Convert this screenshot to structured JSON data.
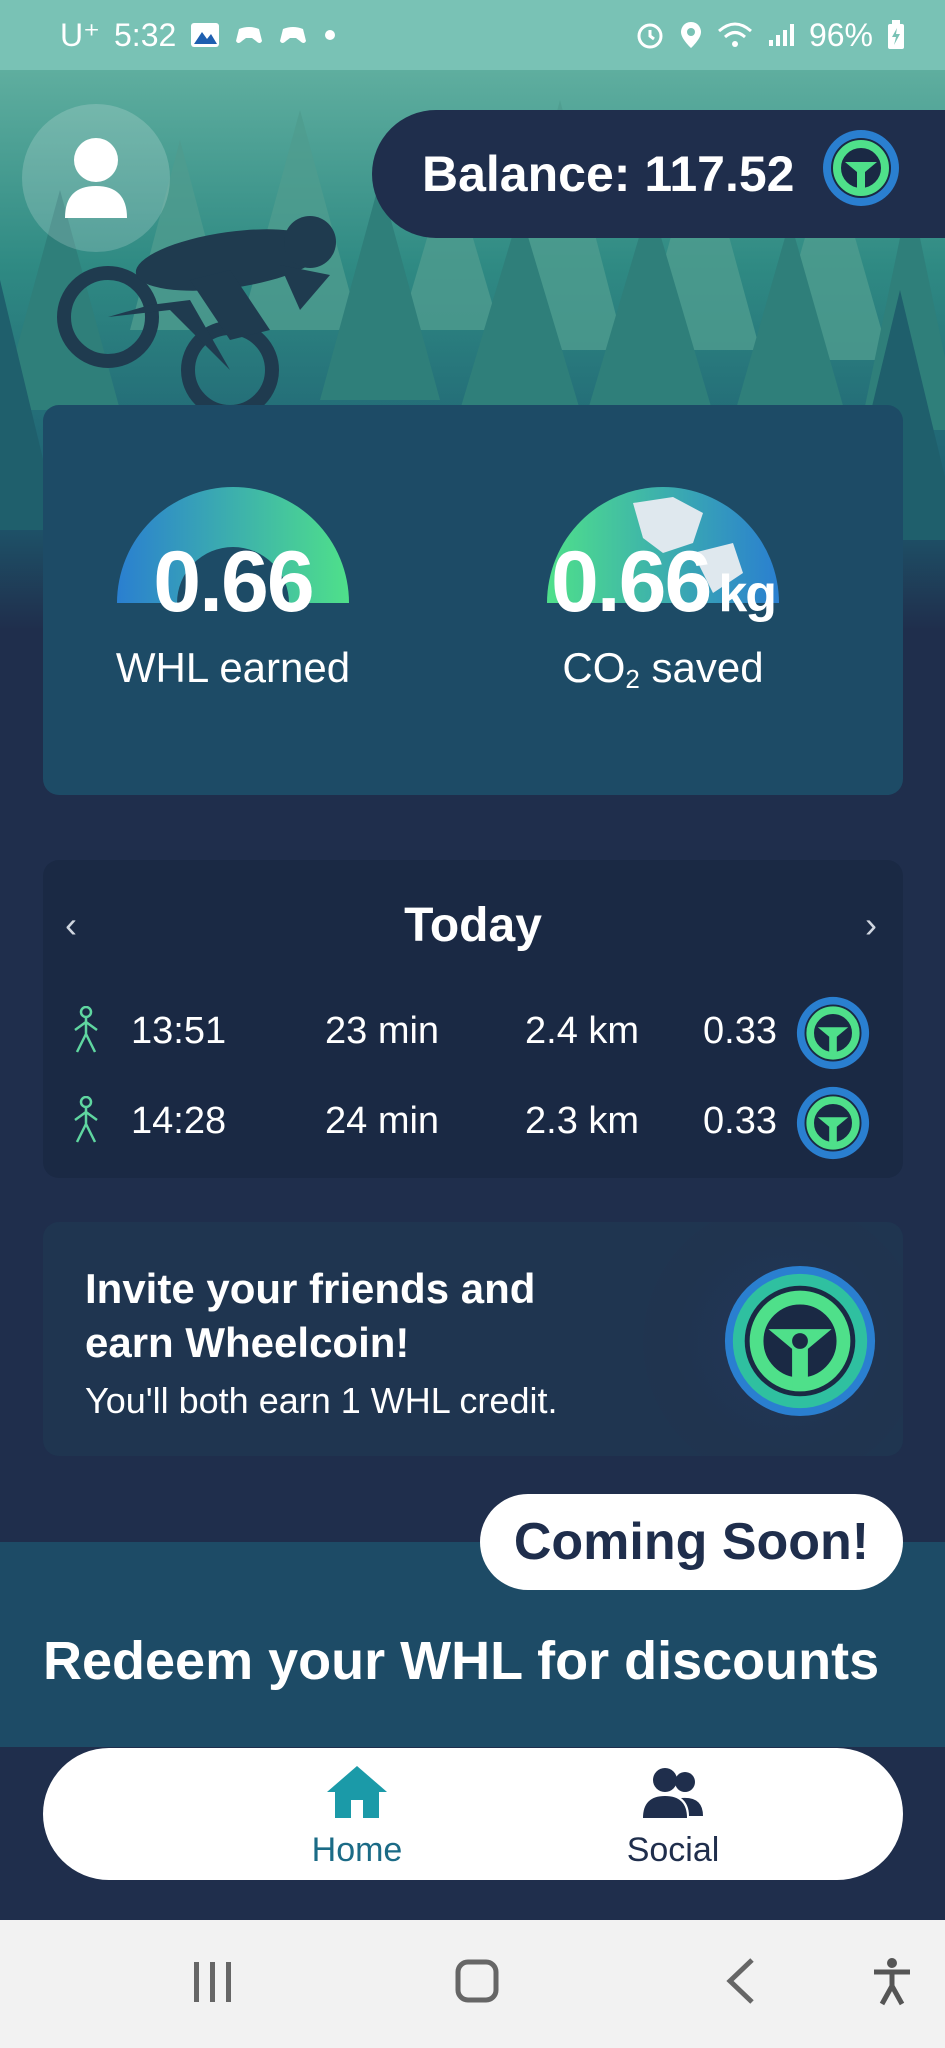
{
  "status_bar": {
    "carrier": "U⁺",
    "time": "5:32",
    "battery": "96%"
  },
  "header": {
    "balance_label": "Balance: 117.52"
  },
  "stats": {
    "whl_value": "0.66",
    "whl_label": "WHL earned",
    "co2_value": "0.66",
    "co2_unit": "kg",
    "co2_label_prefix": "CO",
    "co2_label_sub": "2",
    "co2_label_suffix": " saved"
  },
  "today": {
    "title": "Today",
    "prev": "‹",
    "next": "›",
    "trips": [
      {
        "time": "13:51",
        "duration": "23 min",
        "distance": "2.4 km",
        "whl": "0.33"
      },
      {
        "time": "14:28",
        "duration": "24 min",
        "distance": "2.3 km",
        "whl": "0.33"
      }
    ]
  },
  "invite": {
    "title": "Invite your friends and earn Wheelcoin!",
    "subtitle": "You'll both earn 1 WHL credit."
  },
  "redeem": {
    "badge": "Coming Soon!",
    "title": "Redeem your WHL for discounts"
  },
  "bottom_nav": {
    "home": "Home",
    "social": "Social"
  },
  "colors": {
    "background": "#1f2e4c",
    "accent": "#1b6b86",
    "coin_green": "#4fe08a",
    "coin_blue": "#2a7fd0"
  }
}
